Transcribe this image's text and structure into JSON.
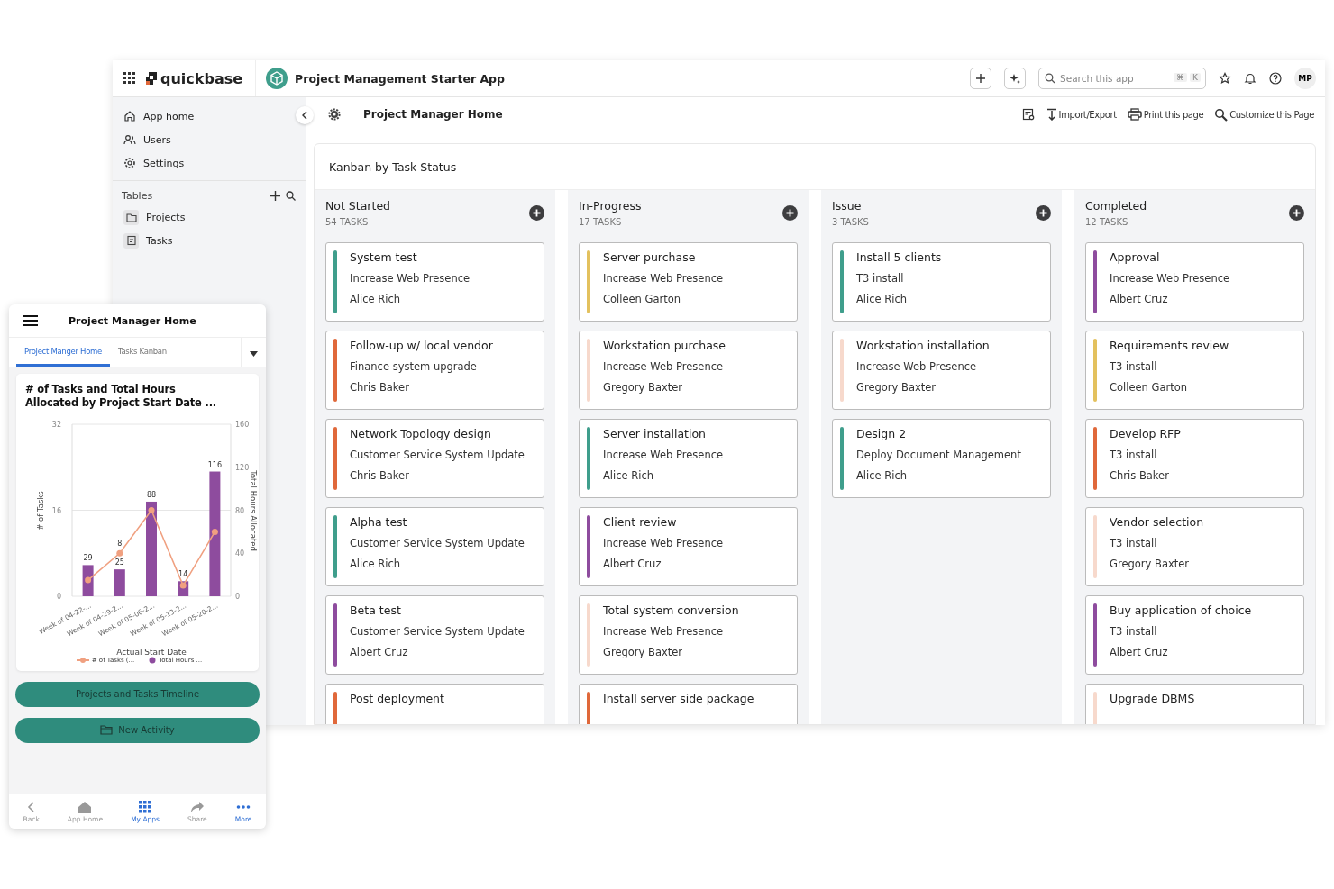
{
  "app_bar": {
    "logo": "quickbase",
    "app_title": "Project Management Starter App",
    "search": {
      "placeholder": "Search this app",
      "shortcut": [
        "⌘",
        "K"
      ]
    },
    "avatar": "MP"
  },
  "sidebar": {
    "items": [
      {
        "label": "App home",
        "kind": "home"
      },
      {
        "label": "Users",
        "kind": "users"
      },
      {
        "label": "Settings",
        "kind": "settings"
      }
    ],
    "tables_heading": "Tables",
    "tables": [
      {
        "label": "Projects",
        "kind": "folder"
      },
      {
        "label": "Tasks",
        "kind": "task"
      }
    ]
  },
  "page_header": {
    "title": "Project Manager Home",
    "actions": [
      {
        "label": "Import/Export",
        "kind": "import"
      },
      {
        "label": "Print this page",
        "kind": "print"
      },
      {
        "label": "Customize this Page",
        "kind": "customize"
      }
    ]
  },
  "kanban": {
    "title": "Kanban by Task Status",
    "columns": [
      {
        "name": "Not Started",
        "count": "54 TASKS",
        "cards": [
          {
            "title": "System test",
            "project": "Increase Web Presence",
            "owner": "Alice Rich",
            "color": "#3f9e8c"
          },
          {
            "title": "Follow-up w/ local vendor",
            "project": "Finance system upgrade",
            "owner": "Chris Baker",
            "color": "#e0683a"
          },
          {
            "title": "Network Topology design",
            "project": "Customer Service System Update",
            "owner": "Chris Baker",
            "color": "#e0683a"
          },
          {
            "title": "Alpha test",
            "project": "Customer Service System Update",
            "owner": "Alice Rich",
            "color": "#3f9e8c"
          },
          {
            "title": "Beta test",
            "project": "Customer Service System Update",
            "owner": "Albert Cruz",
            "color": "#8e4c9e"
          },
          {
            "title": "Post deployment",
            "color": "#e0683a"
          }
        ]
      },
      {
        "name": "In-Progress",
        "count": "17 TASKS",
        "cards": [
          {
            "title": "Server purchase",
            "project": "Increase Web Presence",
            "owner": "Colleen Garton",
            "color": "#e3c15e"
          },
          {
            "title": "Workstation purchase",
            "project": "Increase Web Presence",
            "owner": "Gregory Baxter",
            "color": "#f7d9cc"
          },
          {
            "title": "Server installation",
            "project": "Increase Web Presence",
            "owner": "Alice Rich",
            "color": "#3f9e8c"
          },
          {
            "title": "Client review",
            "project": "Increase Web Presence",
            "owner": "Albert Cruz",
            "color": "#8e4c9e"
          },
          {
            "title": "Total system conversion",
            "project": "Increase Web Presence",
            "owner": "Gregory Baxter",
            "color": "#f7d9cc"
          },
          {
            "title": "Install server side package",
            "color": "#e0683a"
          }
        ]
      },
      {
        "name": "Issue",
        "count": "3 TASKS",
        "cards": [
          {
            "title": "Install 5 clients",
            "project": "T3 install",
            "owner": "Alice Rich",
            "color": "#3f9e8c"
          },
          {
            "title": "Workstation installation",
            "project": "Increase Web Presence",
            "owner": "Gregory Baxter",
            "color": "#f7d9cc"
          },
          {
            "title": "Design 2",
            "project": "Deploy Document Management",
            "owner": "Alice Rich",
            "color": "#3f9e8c"
          }
        ]
      },
      {
        "name": "Completed",
        "count": "12 TASKS",
        "cards": [
          {
            "title": "Approval",
            "project": "Increase Web Presence",
            "owner": "Albert Cruz",
            "color": "#8e4c9e"
          },
          {
            "title": "Requirements review",
            "project": "T3 install",
            "owner": "Colleen Garton",
            "color": "#e3c15e"
          },
          {
            "title": "Develop RFP",
            "project": "T3 install",
            "owner": "Chris Baker",
            "color": "#e0683a"
          },
          {
            "title": "Vendor selection",
            "project": "T3 install",
            "owner": "Gregory Baxter",
            "color": "#f7d9cc"
          },
          {
            "title": "Buy application of choice",
            "project": "T3 install",
            "owner": "Albert Cruz",
            "color": "#8e4c9e"
          },
          {
            "title": "Upgrade DBMS",
            "color": "#f7d9cc"
          }
        ]
      }
    ]
  },
  "mobile": {
    "title": "Project Manager Home",
    "tabs": [
      {
        "label": "Project Manger Home",
        "selected": true
      },
      {
        "label": "Tasks Kanban",
        "selected": false
      }
    ],
    "chart_data": {
      "type": "bar",
      "title": "# of Tasks and Total Hours Allocated by Project Start Date ...",
      "xlabel": "Actual Start Date",
      "ylabel": "Total Hours Allocated",
      "y2label": "# of Tasks",
      "categories": [
        "Week of 04-22-...",
        "Week of 04-29-2...",
        "Week of 05-06-2...",
        "Week of 05-13-2...",
        "Week of 05-20-2..."
      ],
      "series": [
        {
          "name": "Total Hours ...",
          "type": "bar",
          "color": "#8e4c9e",
          "values": [
            29,
            25,
            88,
            14,
            116
          ]
        },
        {
          "name": "# of Tasks (...",
          "type": "line",
          "axis": "y2",
          "marker": "circle",
          "color": "#f0a080",
          "values": [
            3,
            8,
            16,
            2,
            12
          ]
        }
      ],
      "ylim": [
        0,
        160
      ],
      "yticks": [
        0,
        40,
        80,
        120,
        160
      ],
      "y2lim": [
        0,
        32
      ],
      "y2ticks": [
        0,
        16,
        32
      ],
      "value_labels": [
        "29",
        "25",
        "88",
        "14",
        "116"
      ],
      "annotations": [
        {
          "x": "Week of 04-29-2...",
          "text": "8"
        }
      ]
    },
    "buttons": [
      {
        "label": "Projects and Tasks Timeline",
        "kind": "plain"
      },
      {
        "label": "New Activity",
        "kind": "folder"
      }
    ],
    "nav": [
      {
        "label": "Back",
        "kind": "back",
        "selected": false
      },
      {
        "label": "App Home",
        "kind": "home",
        "selected": false
      },
      {
        "label": "My Apps",
        "kind": "apps",
        "selected": true
      },
      {
        "label": "Share",
        "kind": "share",
        "selected": false
      },
      {
        "label": "More",
        "kind": "more",
        "selected": true
      }
    ]
  }
}
